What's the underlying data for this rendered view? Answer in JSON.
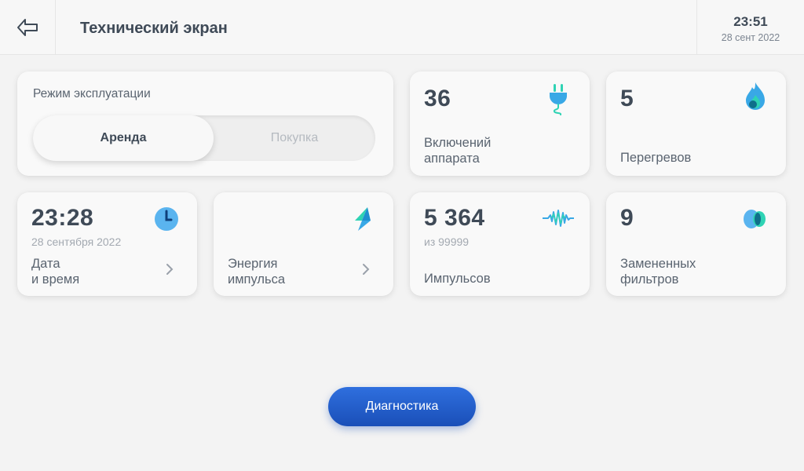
{
  "header": {
    "title": "Технический экран",
    "time": "23:51",
    "date": "28 сент 2022"
  },
  "mode": {
    "title": "Режим эксплуатации",
    "options": [
      "Аренда",
      "Покупка"
    ],
    "selected": "Аренда"
  },
  "cards": {
    "activations": {
      "value": "36",
      "label": "Включений\nаппарата",
      "icon": "plug-icon"
    },
    "overheats": {
      "value": "5",
      "label": "Перегревов",
      "icon": "flame-icon"
    },
    "datetime": {
      "value": "23:28",
      "sub": "28 сентября 2022",
      "label": "Дата\nи время",
      "icon": "clock-icon"
    },
    "energy": {
      "label": "Энергия\nимпульса",
      "icon": "lightning-icon"
    },
    "pulses": {
      "value": "5 364",
      "sub": "из 99999",
      "label": "Импульсов",
      "icon": "wave-icon"
    },
    "filters": {
      "value": "9",
      "label": "Замененных\nфильтров",
      "icon": "filter-icon"
    }
  },
  "diagnostics_label": "Диагностика",
  "colors": {
    "accent": "#1a4fb8",
    "teal": "#2fd3b4",
    "blue": "#39a8e6"
  }
}
